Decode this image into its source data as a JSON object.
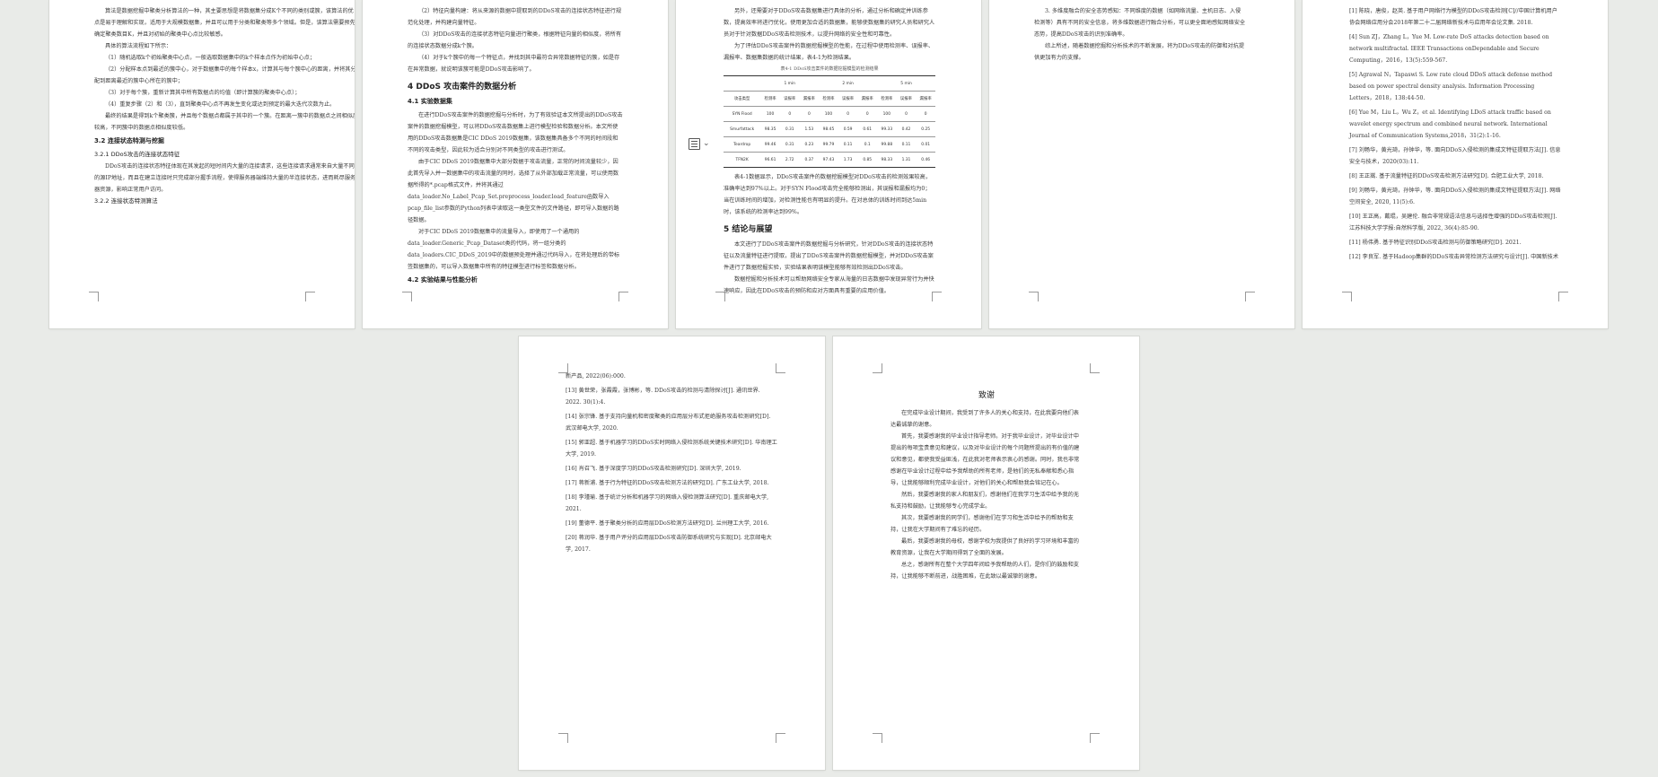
{
  "page1": {
    "paras": [
      "算法是数据挖掘中聚类分析算法的一种，其主要思想是将数据集分成K个不同的类别或簇，该算法的优点是易于理解和实现，适用于大规模数据集，并且可以用于分类和聚类等多个领域。但是，该算法需要预先确定聚类数目K，并且对初始的聚类中心点比较敏感。",
      "具体的算法流程如下所示："
    ],
    "steps": [
      "（1）随机选取k个初始聚类中心点，一般选取数据集中的k个样本点作为初始中心点；",
      "（2）分配样本点到最近的簇中心，对于数据集中的每个样本x，计算其与每个簇中心的距离，并将其分配到距离最近的簇中心所在的簇中；",
      "（3）对于每个簇，重新计算其中所有数据点的均值（即计算簇的聚类中心点）；",
      "（4）重复步骤（2）和（3），直到聚类中心点不再发生变化或达到预定的最大迭代次数为止。"
    ],
    "para_end": "最终的结果是得到k个聚类簇，并且每个数据点都属于其中的一个簇。在距离一簇中的数据点之间相似度较高，不同簇中的数据点相似度较低。",
    "h_32": "3.2 连接状态特测与挖掘",
    "h_321": "3.2.1 DDoS攻击的连接状态特征",
    "para_321": "DDoS攻击的连接状态特征体现在其发起的短时间内大量的连接请求，这些连接请求通常来自大量不同的源IP地址，而且在建立连接时只完成部分握手流程，使得服务器端维持大量的半连接状态，进而耗尽服务器资源，影响正常用户访问。",
    "h_322": "3.2.2 连接状态特测算法"
  },
  "page2": {
    "steps": [
      "（2）特征向量构建：将从来源的数据中提取到的DDoS攻击的连接状态特征进行规范化处理，并构建向量特征。",
      "（3）对DDoS攻击的连接状态特征向量进行聚类，根据特征向量的相似度，将所有的连接状态数据分成k个簇。",
      "（4）对于k个簇中的每一个特征点，并找到其中最符合异常数据特征的簇，如是存在异常数据，就说明该簇可能是DDoS攻击影响了。"
    ],
    "h_4": "4  DDoS 攻击案件的数据分析",
    "h_41": "4.1 实验数据集",
    "para_41a": "在进行DDoS攻击案件的数据挖掘与分析时，为了有效验证本文所提出的DDoS攻击案件的数据挖掘模型，可以将DDoS攻击数据集上进行模型检验和数据分析。本文所使用的DDoS攻击数据集是CIC DDoS 2019数据集，该数据集具备多个不同的时间段和不同的攻击类型，因此较为适合分别对不同类型的攻击进行测试。",
    "para_41b": "由于CIC DDoS 2019数据集中大部分数据于攻击流量，正常的时间流量较少，因此首先导入并一数据集中的攻击流量的同时，选择了从外部加载正常流量，可以使用数据所得的*.pcap格式文件，并将其通过data_loader.No_Label_Pcap_Set.preprocess_loader.load_feature函数导入pcap_file_list参数的Python列表中读取这一类型文件的文件路径，即可导入数据的路径数据。",
    "para_41c": "对于CIC DDoS 2019数据集中的流量导入，即使用了一个通用的data_loader.Generic_Pcap_Dataset类的代码，将一组分类的data_loaders.CIC_DDoS_2019中的数据预处理并通过代码导入，在将处理后的带标签数据集的，可以导入数据集中所有的特征模型进行标签和数据分析。",
    "h_42": "4.2 实验结果与性能分析"
  },
  "page3": {
    "para_top": "另外，还需要对于DDoS攻击数据集进行具体的分析，通过分析和确定并训练参数，提高效率将进行优化，使用更加合适的数据集，能够使数据集的研究人员和研究人员对于针对数据DDoS攻击检测技术，以提升网络的安全性和可靠性。",
    "para_mid": "为了评估DDoS攻击案件的数据挖掘模型的性能，在过程中使用检测率、误报率、漏报率、数据集数据的统计结果，表4-1为检测结果。",
    "table_caption": "表4-1 DDoS攻击案件的数据挖掘模型的检测结果",
    "table_groups": [
      "1 min",
      "2 min",
      "5 min"
    ],
    "table_col_head": "攻击类型",
    "table_sub": [
      "检测率",
      "误报率",
      "漏报率",
      "检测率",
      "误报率",
      "漏报率",
      "检测率",
      "误报率",
      "漏报率"
    ],
    "table_rows": [
      [
        "SYN Flood",
        "100",
        "0",
        "0",
        "100",
        "0",
        "0",
        "100",
        "0",
        "0"
      ],
      [
        "Smurfattack",
        "98.35",
        "0.31",
        "1.53",
        "98.45",
        "0.59",
        "0.61",
        "99.33",
        "0.42",
        "0.25"
      ],
      [
        "Teardrop",
        "99.46",
        "0.31",
        "0.23",
        "99.79",
        "0.11",
        "0.1",
        "99.88",
        "0.11",
        "0.01"
      ],
      [
        "TFN2K",
        "96.61",
        "2.72",
        "0.37",
        "97.43",
        "1.73",
        "0.85",
        "98.33",
        "1.31",
        "0.46"
      ]
    ],
    "para_after": "表4-1数据显示，DDoS攻击案件的数据挖掘模型对DDoS攻击的检测效果较高，准确率达到97%以上。对于SYN Flood攻击完全能够检测出，其误报和漏报均为0；当在训练时间的增加，对检测性能也有明显的提升。在对总体的训练时间到达5min时，该系统的检测率达到99%。",
    "h_5": "5  结论与展望",
    "para_5a": "本文进行了DDoS攻击案件的数据挖掘与分析研究，针对DDoS攻击的连接状态特征以及流量特征进行提取，提出了DDoS攻击案件的数据挖掘模型，并对DDoS攻击案件进行了数据挖掘实验，实验结果表明该模型能够有效检测出DDoS攻击。",
    "para_5b": "数据挖掘和分析技术可以帮助网络安全专家从海量的日志数据中发现异常行为并快速响应，因此在DDoS攻击的预防和应对方面具有重要的应用价值。"
  },
  "page4": {
    "paras": [
      "3. 多维度融合的安全态势感知：不同维度的数据（如网络流量、主机日志、入侵检测等）具有不同的安全信息，将多维数据进行融合分析，可以更全面地感知网络安全态势，提高DDoS攻击的识别准确率。",
      "综上所述，随着数据挖掘和分析技术的不断发展，将为DDoS攻击的防御和对抗提供更加有力的支撑。"
    ]
  },
  "page5": {
    "refs": [
      "[1] 陈晓，唐俊，赵英. 基于用户网络行为模型的DDoS攻击检测[C]//中国计算机用户协会网络应用分会2018年第二十二届网络新技术与应用年会论文集. 2018.",
      "[4] Sun ZJ，Zhang L，Yue M. Low-rate DoS attacks detection based on network multifractal. IEEE Transactions onDependable and Secure Computing，2016，13(5):559-567.",
      "[5] Agrawal N，Tapaswi S. Low rate cloud DDoS attack defense method based on power spectral density analysis. Information Processing Letters，2018，138:44-50.",
      "[6] Yue M，Liu L，Wu Z，et al. Identifying LDoS attack traffic based on wavelet energy spectrum and combined neural network. International Journal of Communication Systems,2018，31(2):1-16.",
      "[7] 刘畅华，黄光琦，孙钟华，等. 面向DDoS入侵检测的集成文特征提取方法[J]. 信息安全与技术，2020(03):11.",
      "[8] 王正嵩. 基于流量特征的DDoS攻击检测方法研究[D]. 合肥工业大学, 2018.",
      "[9] 刘畅华，黄光琦，孙钟华，等. 面向DDoS入侵检测的集成文特征提取方法[J]. 网络空间安全, 2020, 11(5):6.",
      "[10] 王正高，戴琨，吴建伦. 融合非常规语法信息与选择性增强的DDoS攻击检测[J]. 江苏科技大学学报:自然科学版, 2022, 36(4):85-90.",
      "[11] 杨伟勇. 基于特征识别DDoS攻击检测与防御策略研究[D]. 2021.",
      "[12] 李良军. 基于Hadoop集群的DDoS攻击异常检测方法研究与设计[J]. 中国新技术"
    ]
  },
  "page6": {
    "refs": [
      "新产品, 2022(06):000.",
      "[13] 黄世荣，张霞霞，张博彬，等. DDoS攻击的检测与清除探讨[J]. 通讯世界. 2022. 30(1):4.",
      "[14] 张宗锋. 基于支持向量机和密度聚类的应用层分布式拒绝服务攻击检测研究[D]. 武汉邮电大学, 2020.",
      "[15] 郭亚超. 基于机器学习的DDoS实时网络入侵检测系统关键技术研究[D]. 华南理工大学, 2019.",
      "[16] 肖召飞. 基于深度学习的DDoS攻击检测研究[D]. 深圳大学, 2019.",
      "[17] 蒋新浦. 基于行为特征的DDoS攻击检测方法的研究[D]. 广东工业大学, 2018.",
      "[18] 李瑾瑜. 基于统计分析和机器学习的网络入侵检测算法研究[D]. 重庆邮电大学, 2021.",
      "[19] 董德平. 基于聚类分析的应用层DDoS检测方法研究[D]. 兰州理工大学, 2016.",
      "[20] 蒋润华. 基于用户评分的应用层DDoS攻击防御系统研究与实现[D]. 北京邮电大学, 2017."
    ]
  },
  "page7": {
    "title": "致谢",
    "paras": [
      "在完成毕业设计期间，我受到了许多人的关心和支持，在此我要向他们表达最诚挚的谢意。",
      "首先，我要感谢我的毕业设计指导老师。对于我毕业设计，对毕业设计中提出的每项宝贵意见和建议，以及对毕业设计的每个问题所提出的有价值的建议和意见，都使我受益匪浅，在此我对老师表示衷心的感谢。同时，我也非常感谢在毕业设计过程中给予我帮助的所有老师，是他们的无私奉献和悉心指导，让我能够顺利完成毕业设计，对他们的关心和帮助我会铭记在心。",
      "然后，我要感谢我的家人和朋友们，感谢他们在我学习生活中给予我的无私支持和鼓励，让我能够专心完成学业。",
      "其次，我要感谢我的同学们，感谢他们在学习和生活中给予的帮助和支持，让我在大学期间有了难忘的经历。",
      "最后，我要感谢我的母校，感谢学校为我提供了良好的学习环境和丰富的教育资源，让我在大学期间得到了全面的发展。",
      "总之，感谢所有在整个大学四年间给予我帮助的人们，是你们的鼓励和支持，让我能够不断前进，战胜困难，在此致以最诚挚的谢意。"
    ]
  }
}
